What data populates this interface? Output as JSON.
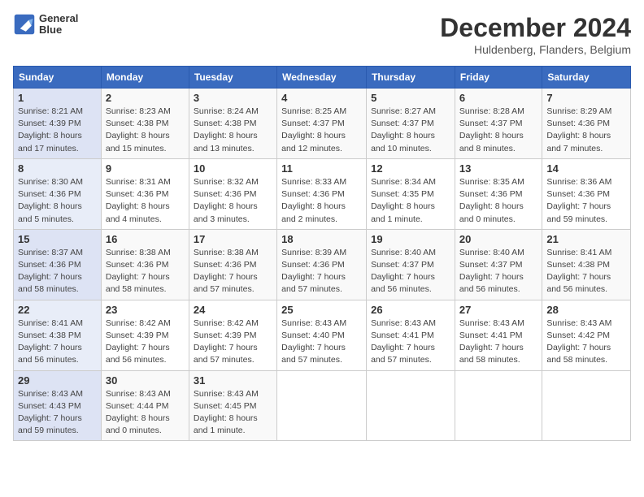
{
  "header": {
    "logo_line1": "General",
    "logo_line2": "Blue",
    "title": "December 2024",
    "subtitle": "Huldenberg, Flanders, Belgium"
  },
  "columns": [
    "Sunday",
    "Monday",
    "Tuesday",
    "Wednesday",
    "Thursday",
    "Friday",
    "Saturday"
  ],
  "weeks": [
    [
      {
        "day": "1",
        "detail": "Sunrise: 8:21 AM\nSunset: 4:39 PM\nDaylight: 8 hours and 17 minutes."
      },
      {
        "day": "2",
        "detail": "Sunrise: 8:23 AM\nSunset: 4:38 PM\nDaylight: 8 hours and 15 minutes."
      },
      {
        "day": "3",
        "detail": "Sunrise: 8:24 AM\nSunset: 4:38 PM\nDaylight: 8 hours and 13 minutes."
      },
      {
        "day": "4",
        "detail": "Sunrise: 8:25 AM\nSunset: 4:37 PM\nDaylight: 8 hours and 12 minutes."
      },
      {
        "day": "5",
        "detail": "Sunrise: 8:27 AM\nSunset: 4:37 PM\nDaylight: 8 hours and 10 minutes."
      },
      {
        "day": "6",
        "detail": "Sunrise: 8:28 AM\nSunset: 4:37 PM\nDaylight: 8 hours and 8 minutes."
      },
      {
        "day": "7",
        "detail": "Sunrise: 8:29 AM\nSunset: 4:36 PM\nDaylight: 8 hours and 7 minutes."
      }
    ],
    [
      {
        "day": "8",
        "detail": "Sunrise: 8:30 AM\nSunset: 4:36 PM\nDaylight: 8 hours and 5 minutes."
      },
      {
        "day": "9",
        "detail": "Sunrise: 8:31 AM\nSunset: 4:36 PM\nDaylight: 8 hours and 4 minutes."
      },
      {
        "day": "10",
        "detail": "Sunrise: 8:32 AM\nSunset: 4:36 PM\nDaylight: 8 hours and 3 minutes."
      },
      {
        "day": "11",
        "detail": "Sunrise: 8:33 AM\nSunset: 4:36 PM\nDaylight: 8 hours and 2 minutes."
      },
      {
        "day": "12",
        "detail": "Sunrise: 8:34 AM\nSunset: 4:35 PM\nDaylight: 8 hours and 1 minute."
      },
      {
        "day": "13",
        "detail": "Sunrise: 8:35 AM\nSunset: 4:36 PM\nDaylight: 8 hours and 0 minutes."
      },
      {
        "day": "14",
        "detail": "Sunrise: 8:36 AM\nSunset: 4:36 PM\nDaylight: 7 hours and 59 minutes."
      }
    ],
    [
      {
        "day": "15",
        "detail": "Sunrise: 8:37 AM\nSunset: 4:36 PM\nDaylight: 7 hours and 58 minutes."
      },
      {
        "day": "16",
        "detail": "Sunrise: 8:38 AM\nSunset: 4:36 PM\nDaylight: 7 hours and 58 minutes."
      },
      {
        "day": "17",
        "detail": "Sunrise: 8:38 AM\nSunset: 4:36 PM\nDaylight: 7 hours and 57 minutes."
      },
      {
        "day": "18",
        "detail": "Sunrise: 8:39 AM\nSunset: 4:36 PM\nDaylight: 7 hours and 57 minutes."
      },
      {
        "day": "19",
        "detail": "Sunrise: 8:40 AM\nSunset: 4:37 PM\nDaylight: 7 hours and 56 minutes."
      },
      {
        "day": "20",
        "detail": "Sunrise: 8:40 AM\nSunset: 4:37 PM\nDaylight: 7 hours and 56 minutes."
      },
      {
        "day": "21",
        "detail": "Sunrise: 8:41 AM\nSunset: 4:38 PM\nDaylight: 7 hours and 56 minutes."
      }
    ],
    [
      {
        "day": "22",
        "detail": "Sunrise: 8:41 AM\nSunset: 4:38 PM\nDaylight: 7 hours and 56 minutes."
      },
      {
        "day": "23",
        "detail": "Sunrise: 8:42 AM\nSunset: 4:39 PM\nDaylight: 7 hours and 56 minutes."
      },
      {
        "day": "24",
        "detail": "Sunrise: 8:42 AM\nSunset: 4:39 PM\nDaylight: 7 hours and 57 minutes."
      },
      {
        "day": "25",
        "detail": "Sunrise: 8:43 AM\nSunset: 4:40 PM\nDaylight: 7 hours and 57 minutes."
      },
      {
        "day": "26",
        "detail": "Sunrise: 8:43 AM\nSunset: 4:41 PM\nDaylight: 7 hours and 57 minutes."
      },
      {
        "day": "27",
        "detail": "Sunrise: 8:43 AM\nSunset: 4:41 PM\nDaylight: 7 hours and 58 minutes."
      },
      {
        "day": "28",
        "detail": "Sunrise: 8:43 AM\nSunset: 4:42 PM\nDaylight: 7 hours and 58 minutes."
      }
    ],
    [
      {
        "day": "29",
        "detail": "Sunrise: 8:43 AM\nSunset: 4:43 PM\nDaylight: 7 hours and 59 minutes."
      },
      {
        "day": "30",
        "detail": "Sunrise: 8:43 AM\nSunset: 4:44 PM\nDaylight: 8 hours and 0 minutes."
      },
      {
        "day": "31",
        "detail": "Sunrise: 8:43 AM\nSunset: 4:45 PM\nDaylight: 8 hours and 1 minute."
      },
      {
        "day": "",
        "detail": ""
      },
      {
        "day": "",
        "detail": ""
      },
      {
        "day": "",
        "detail": ""
      },
      {
        "day": "",
        "detail": ""
      }
    ]
  ]
}
